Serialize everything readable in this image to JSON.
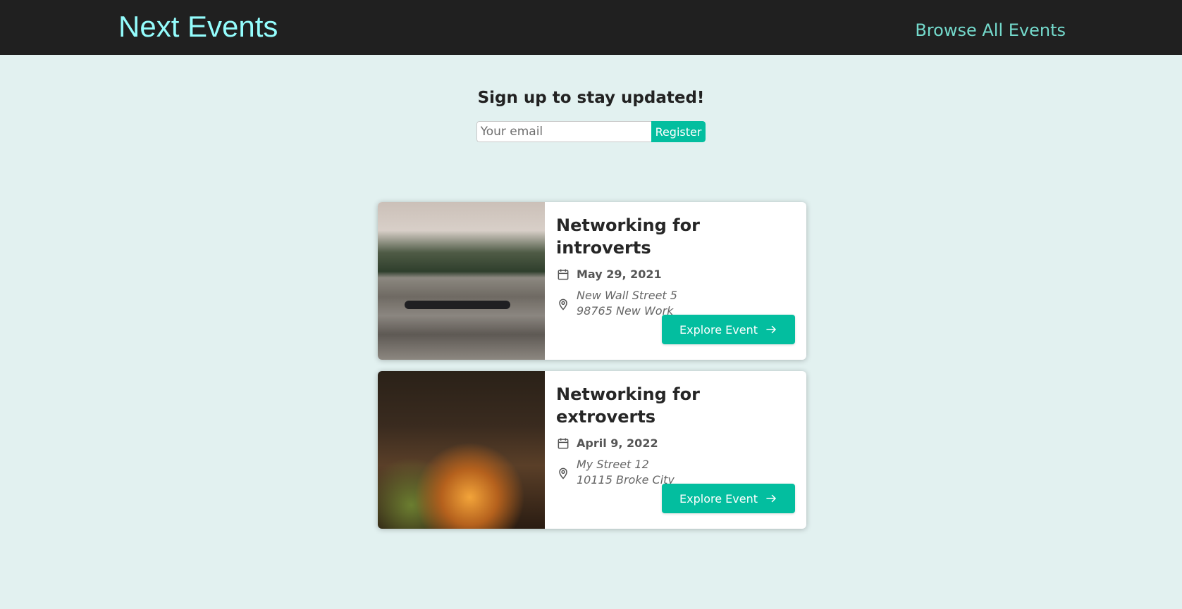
{
  "header": {
    "logo": "Next Events",
    "nav_link": "Browse All Events"
  },
  "signup": {
    "heading": "Sign up to stay updated!",
    "email_placeholder": "Your email",
    "register_label": "Register"
  },
  "events": [
    {
      "title": "Networking for introverts",
      "date": "May 29, 2021",
      "address": "New Wall Street 5\n 98765 New Work",
      "button_label": "Explore Event"
    },
    {
      "title": "Networking for extroverts",
      "date": "April 9, 2022",
      "address": "My Street 12\n 10115 Broke City",
      "button_label": "Explore Event"
    }
  ],
  "colors": {
    "header_bg": "#202020",
    "logo": "#94fdfd",
    "nav_link": "#74dacc",
    "page_bg": "#e2f1f0",
    "accent": "#03be9f"
  },
  "icons": {
    "date": "calendar-icon",
    "address": "location-pin-icon",
    "button": "arrow-right-icon"
  }
}
